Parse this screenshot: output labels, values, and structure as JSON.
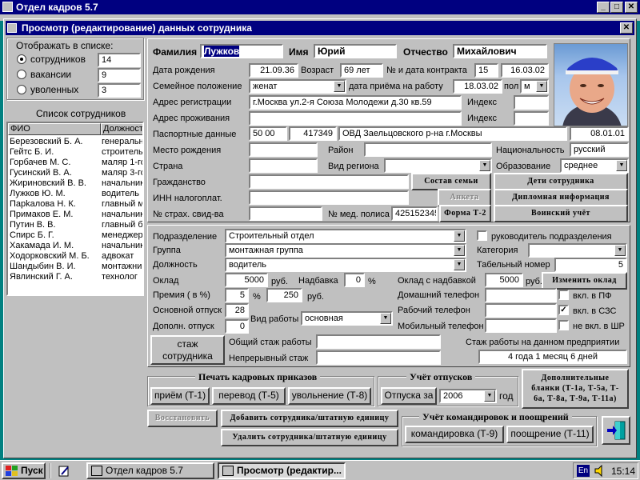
{
  "app": {
    "title": "Отдел кадров 5.7",
    "min_label": "_",
    "max_label": "□",
    "close_label": "✕"
  },
  "dialog": {
    "title": "Просмотр (редактирование) данных сотрудника",
    "close_label": "✕"
  },
  "left_panel": {
    "display_label": "Отображать в списке:",
    "options": [
      {
        "label": "сотрудников",
        "count": "14",
        "selected": true
      },
      {
        "label": "вакансии",
        "count": "9",
        "selected": false
      },
      {
        "label": "уволенных",
        "count": "3",
        "selected": false
      }
    ],
    "list_title": "Список сотрудников",
    "columns": [
      "ФИО",
      "Должност"
    ],
    "employees": [
      {
        "name": "Березовский Б. А.",
        "position": "генеральн"
      },
      {
        "name": "Гейтс Б. И.",
        "position": "строитель"
      },
      {
        "name": "Горбачев М. С.",
        "position": "маляр 1-го"
      },
      {
        "name": "Гусинский В. А.",
        "position": "маляр 3-го"
      },
      {
        "name": "Жириновский В. В.",
        "position": "начальник"
      },
      {
        "name": "Лужков Ю. М.",
        "position": "водитель"
      },
      {
        "name": "Парkалова Н. К.",
        "position": "главный м"
      },
      {
        "name": "Примаков Е. М.",
        "position": "начальник"
      },
      {
        "name": "Путин В. В.",
        "position": "главный б"
      },
      {
        "name": "Спирс Б. Г.",
        "position": "менеджер"
      },
      {
        "name": "Хакамада И. М.",
        "position": "начальник"
      },
      {
        "name": "Ходорковский М. Б.",
        "position": "адвокат"
      },
      {
        "name": "Шандыбин В. И.",
        "position": "монтажни"
      },
      {
        "name": "Явлинский Г. А.",
        "position": "технолог"
      }
    ]
  },
  "personal": {
    "surname_label": "Фамилия",
    "surname": "Лужков",
    "name_label": "Имя",
    "name": "Юрий",
    "patronymic_label": "Отчество",
    "patronymic": "Михайлович",
    "birth_label": "Дата рождения",
    "birth_date": "21.09.36",
    "age_label": "Возраст",
    "age": "69 лет",
    "contract_label": "№ и дата контракта",
    "contract_no": "15",
    "contract_date": "16.03.02",
    "family_label": "Семейное положение",
    "family": "женат",
    "hire_label": "дата приёма на работу",
    "hire_date": "18.03.02",
    "sex_label": "пол",
    "sex": "м",
    "reg_label": "Адрес регистрации",
    "reg_address": "г.Москва ул.2-я Союза Молодежи д.30 кв.59",
    "index_label": "Индекс",
    "live_label": "Адрес проживания",
    "passport_label": "Паспортные данные",
    "passport_series": "50 00",
    "passport_no": "417349",
    "passport_issuer": "ОВД Заельцовского р-на г.Москвы",
    "passport_date": "08.01.01",
    "birthplace_label": "Место рождения",
    "district_label": "Район",
    "nationality_label": "Национальность",
    "nationality": "русский",
    "country_label": "Страна",
    "region_type_label": "Вид региона",
    "education_label": "Образование",
    "education": "среднее",
    "citizenship_label": "Гражданство",
    "inn_label": "ИНН налогоплат.",
    "insurance_label": "№ страх. свид-ва",
    "med_label": "№ мед. полиса",
    "med_no": "425152345",
    "family_btn": "Состав семьи",
    "children_btn": "Дети сотрудника",
    "anketa_btn": "Анкета",
    "diploma_btn": "Дипломная информация",
    "t2_btn": "Форма Т-2",
    "military_btn": "Воинский учёт"
  },
  "job": {
    "dept_label": "Подразделение",
    "dept": "Строительный отдел",
    "head_label": "руководитель подразделения",
    "group_label": "Группа",
    "group": "монтажная группа",
    "category_label": "Категория",
    "position_label": "Должность",
    "position": "водитель",
    "tab_label": "Табельный номер",
    "tab_no": "5",
    "salary_label": "Оклад",
    "salary": "5000",
    "rub": "руб.",
    "bonus_label": "Надбавка",
    "bonus": "0",
    "percent": "%",
    "salary_total_label": "Оклад с надбавкой",
    "salary_total": "5000",
    "change_salary_btn": "Изменить оклад",
    "premium_label": "Премия ( в %)",
    "premium_pct": "5",
    "premium_rub": "250",
    "home_phone_label": "Домашний телефон",
    "pf_label": "вкл. в ПФ",
    "main_leave_label": "Основной отпуск",
    "main_leave": "28",
    "work_phone_label": "Рабочий телефон",
    "sze_label": "вкл. в СЗС",
    "extra_leave_label": "Дополн. отпуск",
    "extra_leave": "0",
    "work_type_label": "Вид работы",
    "work_type": "основная",
    "mobile_label": "Мобильный телефон",
    "shr_label": "не вкл. в ШР",
    "stazh_btn": "стаж сотрудника",
    "total_stazh_label": "Общий стаж работы",
    "cont_stazh_label": "Непрерывный стаж",
    "company_stazh_label": "Стаж работы на данном предприятии",
    "company_stazh": "4 года 1 месяц 6 дней"
  },
  "orders": {
    "title": "Печать кадровых приказов",
    "hire_btn": "приём (Т-1)",
    "transfer_btn": "перевод (Т-5)",
    "fire_btn": "увольнение (Т-8)"
  },
  "vacation": {
    "title": "Учёт отпусков",
    "btn": "Отпуска за",
    "year": "2006",
    "year_label": "год"
  },
  "extra_forms_btn": {
    "line1": "Дополнительные",
    "line2": "бланки (Т-1а, Т-5а, Т-",
    "line3": "6а, Т-8а, Т-9а, Т-11а)"
  },
  "actions": {
    "restore_btn": "Восстановить",
    "add_btn": "Добавить сотрудника/штатную единицу",
    "delete_btn": "Удалить сотрудника/штатную единицу"
  },
  "trips": {
    "title": "Учёт командировок и поощрений",
    "trip_btn": "командировка (Т-9)",
    "bonus_btn": "поощрение (Т-11)"
  },
  "taskbar": {
    "start": "Пуск",
    "task1": "Отдел кадров 5.7",
    "task2": "Просмотр (редактир...",
    "lang": "En",
    "time": "15:14"
  }
}
